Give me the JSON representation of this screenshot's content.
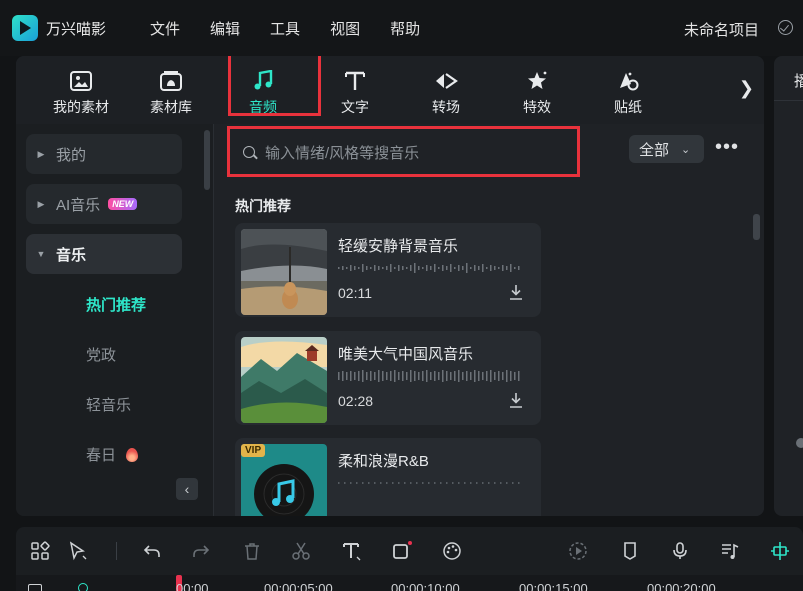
{
  "app": {
    "name": "万兴喵影",
    "project_name": "未命名项目"
  },
  "menu": [
    "文件",
    "编辑",
    "工具",
    "视图",
    "帮助"
  ],
  "tabs": [
    {
      "label": "我的素材",
      "icon": "my-media-icon",
      "active": false
    },
    {
      "label": "素材库",
      "icon": "stock-library-icon",
      "active": false
    },
    {
      "label": "音频",
      "icon": "music-note-icon",
      "active": true
    },
    {
      "label": "文字",
      "icon": "text-icon",
      "active": false
    },
    {
      "label": "转场",
      "icon": "transition-icon",
      "active": false
    },
    {
      "label": "特效",
      "icon": "effects-icon",
      "active": false
    },
    {
      "label": "贴纸",
      "icon": "sticker-icon",
      "active": false
    }
  ],
  "right_panel": {
    "tab_label": "播"
  },
  "sidebar": {
    "items": [
      {
        "label": "我的"
      },
      {
        "label": "AI音乐",
        "badge": "NEW"
      },
      {
        "label": "音乐"
      }
    ],
    "subitems": [
      {
        "label": "热门推荐",
        "selected": true
      },
      {
        "label": "党政"
      },
      {
        "label": "轻音乐"
      },
      {
        "label": "春日",
        "hot": true
      }
    ]
  },
  "search": {
    "placeholder": "输入情绪/风格等搜音乐"
  },
  "filter": {
    "value": "全部"
  },
  "section_title": "热门推荐",
  "tracks": [
    {
      "name": "轻缓安静背景音乐",
      "duration": "02:11",
      "vip": false
    },
    {
      "name": "唯美大气中国风音乐",
      "duration": "02:28",
      "vip": false
    },
    {
      "name": "柔和浪漫R&B",
      "duration": "",
      "vip": true,
      "vip_label": "VIP"
    }
  ],
  "timeline": {
    "timecodes": [
      "00:00",
      "00:00:05:00",
      "00:00:10:00",
      "00:00:15:00",
      "00:00:20:00"
    ]
  },
  "colors": {
    "accent": "#2ee6c9",
    "highlight_box": "#e8323c",
    "background": "#121416"
  }
}
